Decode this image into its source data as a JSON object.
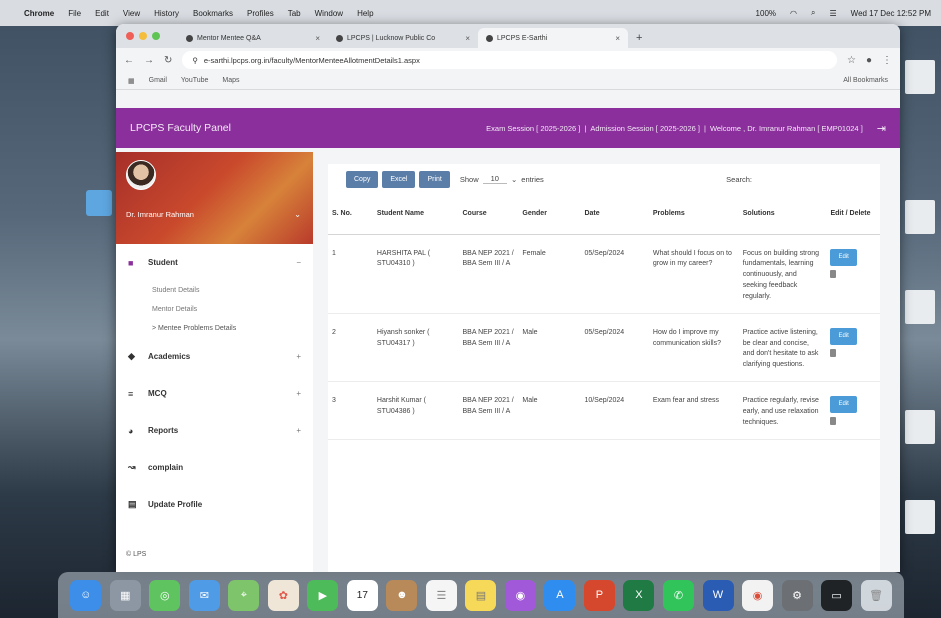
{
  "menubar": {
    "apple": "",
    "items": [
      "Chrome",
      "File",
      "Edit",
      "View",
      "History",
      "Bookmarks",
      "Profiles",
      "Tab",
      "Window",
      "Help"
    ],
    "battery": "100%",
    "clock": "Wed 17 Dec 12:52 PM"
  },
  "browser": {
    "tabs": [
      {
        "title": "Mentor Mentee Q&A"
      },
      {
        "title": "LPCPS | Lucknow Public Co"
      },
      {
        "title": "LPCPS E-Sarthi"
      }
    ],
    "url": "e-sarthi.lpcps.org.in/faculty/MentorMenteeAllotmentDetails1.aspx",
    "bookmarks": [
      "Gmail",
      "YouTube",
      "Maps"
    ],
    "all_bookmarks": "All Bookmarks"
  },
  "header": {
    "brand": "LPCPS Faculty Panel",
    "exam_session": "Exam Session [ 2025-2026 ]",
    "admission_session": "Admission Session [ 2025-2026 ]",
    "welcome": "Welcome , Dr. Imranur Rahman [ EMP01024 ]"
  },
  "sidebar": {
    "profile_name": "Dr. Imranur Rahman",
    "student": "Student",
    "sub_items": [
      "Student Details",
      "Mentor Details",
      "> Mentee Problems Details"
    ],
    "items": [
      {
        "label": "Academics",
        "icon": "graduation-icon"
      },
      {
        "label": "MCQ",
        "icon": "list-icon"
      },
      {
        "label": "Reports",
        "icon": "chart-icon"
      },
      {
        "label": "complain",
        "icon": "trend-icon"
      },
      {
        "label": "Update Profile",
        "icon": "card-icon"
      }
    ],
    "footer": "© LPS"
  },
  "controls": {
    "copy": "Copy",
    "excel": "Excel",
    "print": "Print",
    "show": "Show",
    "entries_value": "10",
    "entries": "entries",
    "search": "Search:"
  },
  "table": {
    "headers": [
      "S. No.",
      "Student Name",
      "Course",
      "Gender",
      "Date",
      "Problems",
      "Solutions",
      "Edit / Delete"
    ],
    "edit_label": "Edit",
    "rows": [
      {
        "sno": "1",
        "name": "HARSHITA PAL ( STU04310 )",
        "course": "BBA NEP 2021 / BBA Sem III / A",
        "gender": "Female",
        "date": "05/Sep/2024",
        "problem": "What should I focus on to grow in my career?",
        "solution": "Focus on building strong fundamentals, learning continuously, and seeking feedback regularly."
      },
      {
        "sno": "2",
        "name": "Hiyansh sonker ( STU04317 )",
        "course": "BBA NEP 2021 / BBA Sem III / A",
        "gender": "Male",
        "date": "05/Sep/2024",
        "problem": "How do I improve my communication skills?",
        "solution": "Practice active listening, be clear and concise, and don't hesitate to ask clarifying questions."
      },
      {
        "sno": "3",
        "name": "Harshit Kumar ( STU04386 )",
        "course": "BBA NEP 2021 / BBA Sem III / A",
        "gender": "Male",
        "date": "10/Sep/2024",
        "problem": "Exam fear and stress",
        "solution": "Practice regularly, revise early, and use relaxation techniques."
      }
    ]
  },
  "dock": {
    "calendar_day": "17",
    "icons": [
      "finder-icon",
      "launchpad-icon",
      "messages-icon",
      "mail-icon",
      "maps-icon",
      "photos-icon",
      "facetime-icon",
      "calendar-icon",
      "contacts-icon",
      "reminders-icon",
      "notes-icon",
      "podcasts-icon",
      "appstore-icon",
      "powerpoint-icon",
      "excel-icon",
      "whatsapp-icon",
      "word-icon",
      "chrome-icon",
      "settings-icon",
      "terminal-icon",
      "trash-icon"
    ]
  }
}
